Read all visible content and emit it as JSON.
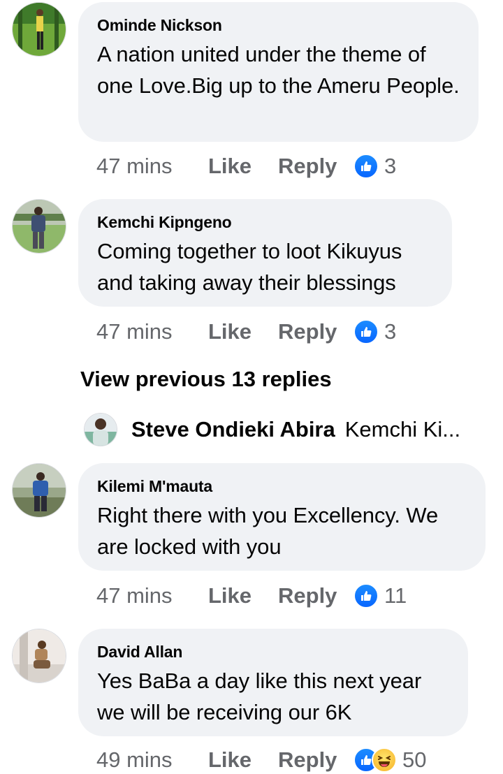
{
  "comments": [
    {
      "author": "Ominde Nickson",
      "text": "A nation united under the theme of one Love.Big up to the Ameru People.",
      "time": "47 mins",
      "like_label": "Like",
      "reply_label": "Reply",
      "reactions": [
        "like-icon"
      ],
      "reaction_count": "3"
    },
    {
      "author": "Kemchi Kipngeno",
      "text": "Coming together to loot Kikuyus and taking away their blessings",
      "time": "47 mins",
      "like_label": "Like",
      "reply_label": "Reply",
      "reactions": [
        "like-icon"
      ],
      "reaction_count": "3"
    },
    {
      "author": "Kilemi M'mauta",
      "text": "Right there with you Excellency. We are locked with you",
      "time": "47 mins",
      "like_label": "Like",
      "reply_label": "Reply",
      "reactions": [
        "like-icon"
      ],
      "reaction_count": "11"
    },
    {
      "author": "David Allan",
      "text": "Yes BaBa a day  like this next year we will be receiving our 6K",
      "time": "49 mins",
      "like_label": "Like",
      "reply_label": "Reply",
      "reactions": [
        "like-icon",
        "haha-icon"
      ],
      "reaction_count": "50"
    }
  ],
  "view_previous_replies": "View previous 13 replies",
  "collapsed_reply": {
    "author": "Steve Ondieki Abira",
    "snippet": "Kemchi Ki..."
  },
  "colors": {
    "bubble": "#f0f2f5",
    "meta_text": "#65676b",
    "like_blue": "#0866ff"
  }
}
